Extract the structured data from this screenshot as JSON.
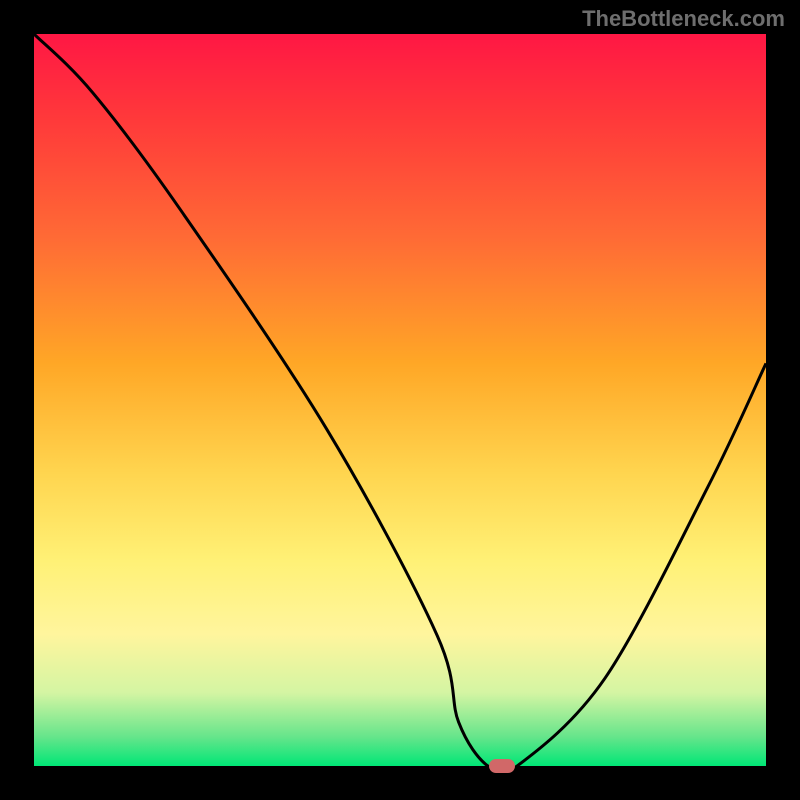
{
  "watermark": "TheBottleneck.com",
  "chart_data": {
    "type": "line",
    "title": "",
    "xlabel": "",
    "ylabel": "",
    "xlim": [
      0,
      100
    ],
    "ylim": [
      0,
      100
    ],
    "series": [
      {
        "name": "bottleneck-curve",
        "x": [
          0,
          8,
          20,
          40,
          55,
          58,
          62,
          66,
          78,
          92,
          100
        ],
        "y": [
          100,
          92,
          76,
          46,
          18,
          6,
          0,
          0,
          12,
          38,
          55
        ]
      }
    ],
    "marker": {
      "x": 64,
      "y": 0,
      "color": "#d16868"
    },
    "gradient_stops": [
      {
        "pos": 0,
        "color": "#ff1744"
      },
      {
        "pos": 12,
        "color": "#ff3a3a"
      },
      {
        "pos": 28,
        "color": "#ff6b35"
      },
      {
        "pos": 45,
        "color": "#ffa726"
      },
      {
        "pos": 60,
        "color": "#ffd54f"
      },
      {
        "pos": 72,
        "color": "#fff176"
      },
      {
        "pos": 82,
        "color": "#fff59d"
      },
      {
        "pos": 90,
        "color": "#d4f5a3"
      },
      {
        "pos": 96,
        "color": "#66e58b"
      },
      {
        "pos": 100,
        "color": "#00e676"
      }
    ]
  }
}
